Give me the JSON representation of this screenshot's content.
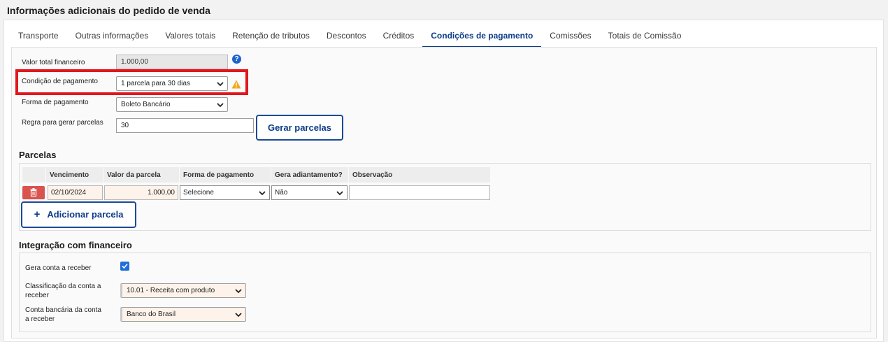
{
  "page": {
    "title": "Informações adicionais do pedido de venda"
  },
  "tabs": [
    {
      "label": "Transporte"
    },
    {
      "label": "Outras informações"
    },
    {
      "label": "Valores totais"
    },
    {
      "label": "Retenção de tributos"
    },
    {
      "label": "Descontos"
    },
    {
      "label": "Créditos"
    },
    {
      "label": "Condições de pagamento"
    },
    {
      "label": "Comissões"
    },
    {
      "label": "Totais de Comissão"
    }
  ],
  "active_tab": "Condições de pagamento",
  "form": {
    "valor_total": {
      "label": "Valor total financeiro",
      "value": "1.000,00"
    },
    "condicao": {
      "label": "Condição de pagamento",
      "value": "1 parcela para 30 dias"
    },
    "forma": {
      "label": "Forma de pagamento",
      "value": "Boleto Bancário"
    },
    "regra": {
      "label": "Regra para gerar parcelas",
      "value": "30"
    },
    "gerar_button": "Gerar parcelas",
    "help_symbol": "?"
  },
  "parcelas": {
    "title": "Parcelas",
    "columns": [
      "Vencimento",
      "Valor da parcela",
      "Forma de pagamento",
      "Gera adiantamento?",
      "Observação"
    ],
    "rows": [
      {
        "vencimento": "02/10/2024",
        "valor": "1.000,00",
        "forma": "Selecione",
        "adiantamento": "Não",
        "observacao": ""
      }
    ],
    "add_button": "Adicionar parcela",
    "add_symbol": "+"
  },
  "integracao": {
    "title": "Integração com financeiro",
    "gera_conta": {
      "label": "Gera conta a receber",
      "checked": true
    },
    "classificacao": {
      "label": "Classificação da conta a receber",
      "value": "10.01 - Receita com produto"
    },
    "conta_bancaria": {
      "label": "Conta bancária da conta a receber",
      "value": "Banco do Brasil"
    }
  },
  "colors": {
    "accent": "#0d3c88",
    "highlight": "#e3161b",
    "warning": "#f0a91a",
    "danger": "#d9534f",
    "help": "#1e63cc"
  }
}
